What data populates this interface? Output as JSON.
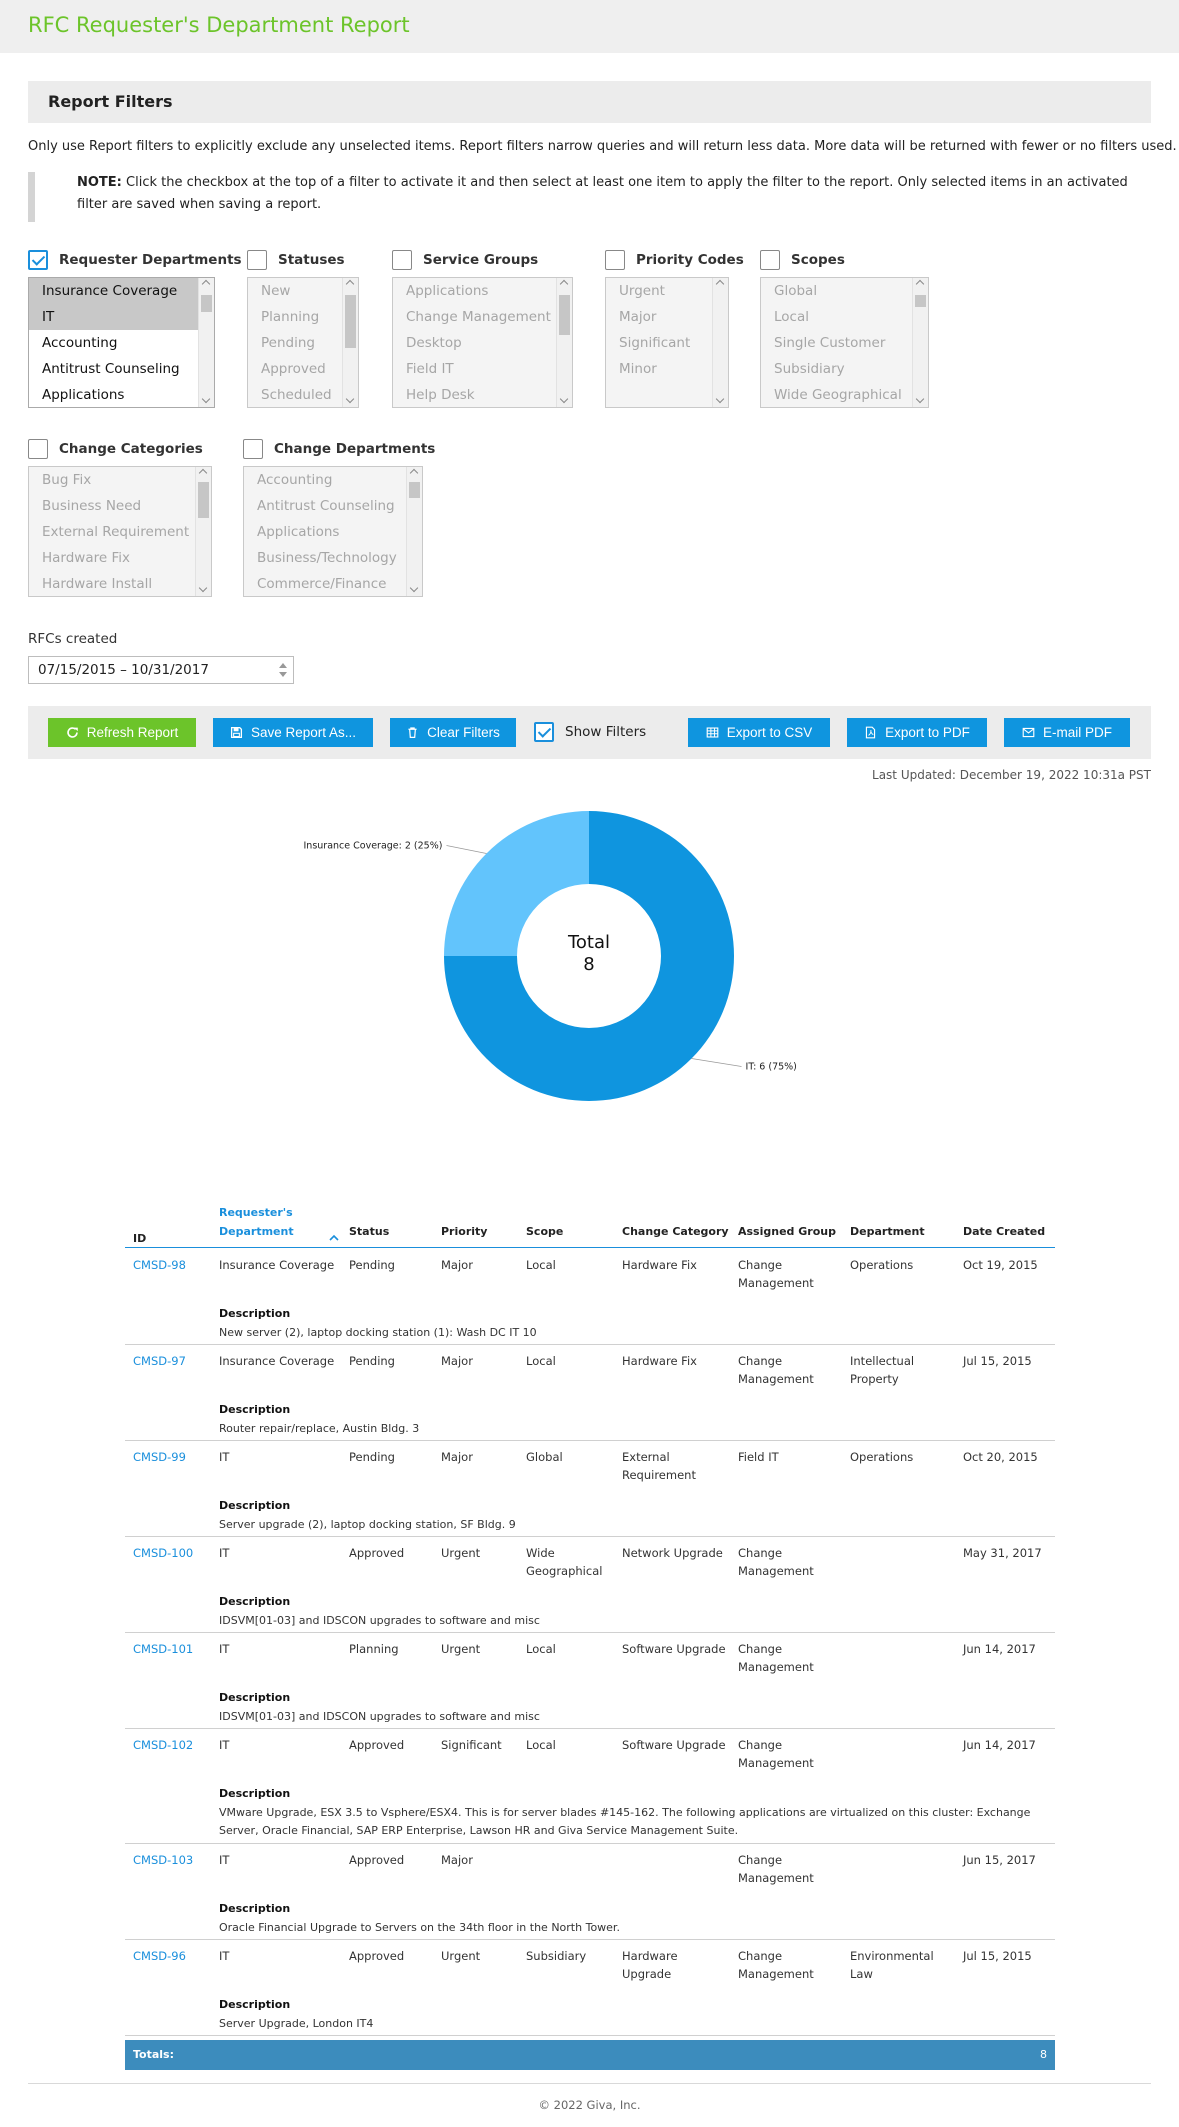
{
  "app": {
    "title": "RFC Requester's Department Report"
  },
  "filters": {
    "header": "Report Filters",
    "intro": "Only use Report filters to explicitly exclude any unselected items. Report filters narrow queries and will return less data. More data will be returned with fewer or no filters used.",
    "note_bold": "NOTE:",
    "note_text": " Click the checkbox at the top of a filter to activate it and then select at least one item to apply the filter to the report. Only selected items in an activated filter are saved when saving a report.",
    "groups": [
      {
        "label": "Requester Departments",
        "checked": true,
        "items": [
          "Insurance Coverage",
          "IT",
          "Accounting",
          "Antitrust Counseling",
          "Applications"
        ],
        "selected": [
          0,
          1
        ]
      },
      {
        "label": "Statuses",
        "checked": false,
        "items": [
          "New",
          "Planning",
          "Pending",
          "Approved",
          "Scheduled"
        ],
        "selected": []
      },
      {
        "label": "Service Groups",
        "checked": false,
        "items": [
          "Applications",
          "Change Management",
          "Desktop",
          "Field IT",
          "Help Desk"
        ],
        "selected": []
      },
      {
        "label": "Priority Codes",
        "checked": false,
        "items": [
          "Urgent",
          "Major",
          "Significant",
          "Minor"
        ],
        "selected": []
      },
      {
        "label": "Scopes",
        "checked": false,
        "items": [
          "Global",
          "Local",
          "Single Customer",
          "Subsidiary",
          "Wide Geographical"
        ],
        "selected": []
      },
      {
        "label": "Change Categories",
        "checked": false,
        "items": [
          "Bug Fix",
          "Business Need",
          "External Requirement",
          "Hardware Fix",
          "Hardware Install"
        ],
        "selected": []
      },
      {
        "label": "Change Departments",
        "checked": false,
        "items": [
          "Accounting",
          "Antitrust Counseling",
          "Applications",
          "Business/Technology",
          "Commerce/Finance"
        ],
        "selected": []
      }
    ],
    "rfcs_created_label": "RFCs created",
    "date_range": "07/15/2015 – 10/31/2017"
  },
  "toolbar": {
    "refresh": "Refresh Report",
    "save": "Save Report As...",
    "clear": "Clear Filters",
    "show_filters": "Show Filters",
    "show_filters_checked": true,
    "export_csv": "Export to CSV",
    "export_pdf": "Export to PDF",
    "email_pdf": "E-mail PDF"
  },
  "last_updated": "Last Updated: December 19, 2022 10:31a PST",
  "chart_data": {
    "type": "pie",
    "donut": true,
    "categories": [
      "IT",
      "Insurance Coverage"
    ],
    "values": [
      6,
      2
    ],
    "labels": [
      "IT: 6 (75%)",
      "Insurance Coverage: 2 (25%)"
    ],
    "colors": [
      "#0f95df",
      "#62c4fc"
    ],
    "center_label": "Total",
    "center_value": "8"
  },
  "table": {
    "columns": [
      "ID",
      "Requester's",
      "Department",
      "Status",
      "Priority",
      "Scope",
      "Change Category",
      "Assigned Group",
      "Department",
      "Date Created"
    ],
    "description_label": "Description",
    "rows": [
      {
        "id": "CMSD-98",
        "req_dept": "Insurance Coverage",
        "status": "Pending",
        "priority": "Major",
        "scope": "Local",
        "category": "Hardware Fix",
        "group": "Change Management",
        "dept": "Operations",
        "date": "Oct 19, 2015",
        "desc": "New server (2), laptop docking station (1): Wash DC IT 10"
      },
      {
        "id": "CMSD-97",
        "req_dept": "Insurance Coverage",
        "status": "Pending",
        "priority": "Major",
        "scope": "Local",
        "category": "Hardware Fix",
        "group": "Change Management",
        "dept": "Intellectual Property",
        "date": "Jul 15, 2015",
        "desc": "Router repair/replace, Austin Bldg. 3"
      },
      {
        "id": "CMSD-99",
        "req_dept": "IT",
        "status": "Pending",
        "priority": "Major",
        "scope": "Global",
        "category": "External Requirement",
        "group": "Field IT",
        "dept": "Operations",
        "date": "Oct 20, 2015",
        "desc": "Server upgrade (2), laptop docking station, SF Bldg. 9"
      },
      {
        "id": "CMSD-100",
        "req_dept": "IT",
        "status": "Approved",
        "priority": "Urgent",
        "scope": "Wide Geographical",
        "category": "Network Upgrade",
        "group": "Change Management",
        "dept": "",
        "date": "May 31, 2017",
        "desc": "IDSVM[01-03] and IDSCON upgrades to software and misc"
      },
      {
        "id": "CMSD-101",
        "req_dept": "IT",
        "status": "Planning",
        "priority": "Urgent",
        "scope": "Local",
        "category": "Software Upgrade",
        "group": "Change Management",
        "dept": "",
        "date": "Jun 14, 2017",
        "desc": "IDSVM[01-03] and IDSCON upgrades to software and misc"
      },
      {
        "id": "CMSD-102",
        "req_dept": "IT",
        "status": "Approved",
        "priority": "Significant",
        "scope": "Local",
        "category": "Software Upgrade",
        "group": "Change Management",
        "dept": "",
        "date": "Jun 14, 2017",
        "desc": "VMware Upgrade, ESX 3.5 to Vsphere/ESX4. This is for server blades #145-162. The following applications are virtualized on this cluster: Exchange Server, Oracle Financial, SAP ERP Enterprise, Lawson HR and Giva Service Management Suite."
      },
      {
        "id": "CMSD-103",
        "req_dept": "IT",
        "status": "Approved",
        "priority": "Major",
        "scope": "",
        "category": "",
        "group": "Change Management",
        "dept": "",
        "date": "Jun 15, 2017",
        "desc": "Oracle Financial Upgrade to Servers on the 34th floor in the North Tower."
      },
      {
        "id": "CMSD-96",
        "req_dept": "IT",
        "status": "Approved",
        "priority": "Urgent",
        "scope": "Subsidiary",
        "category": "Hardware Upgrade",
        "group": "Change Management",
        "dept": "Environmental Law",
        "date": "Jul 15, 2015",
        "desc": "Server Upgrade, London IT4"
      }
    ],
    "totals_label": "Totals:",
    "totals_value": "8"
  },
  "footer": "© 2022 Giva, Inc."
}
